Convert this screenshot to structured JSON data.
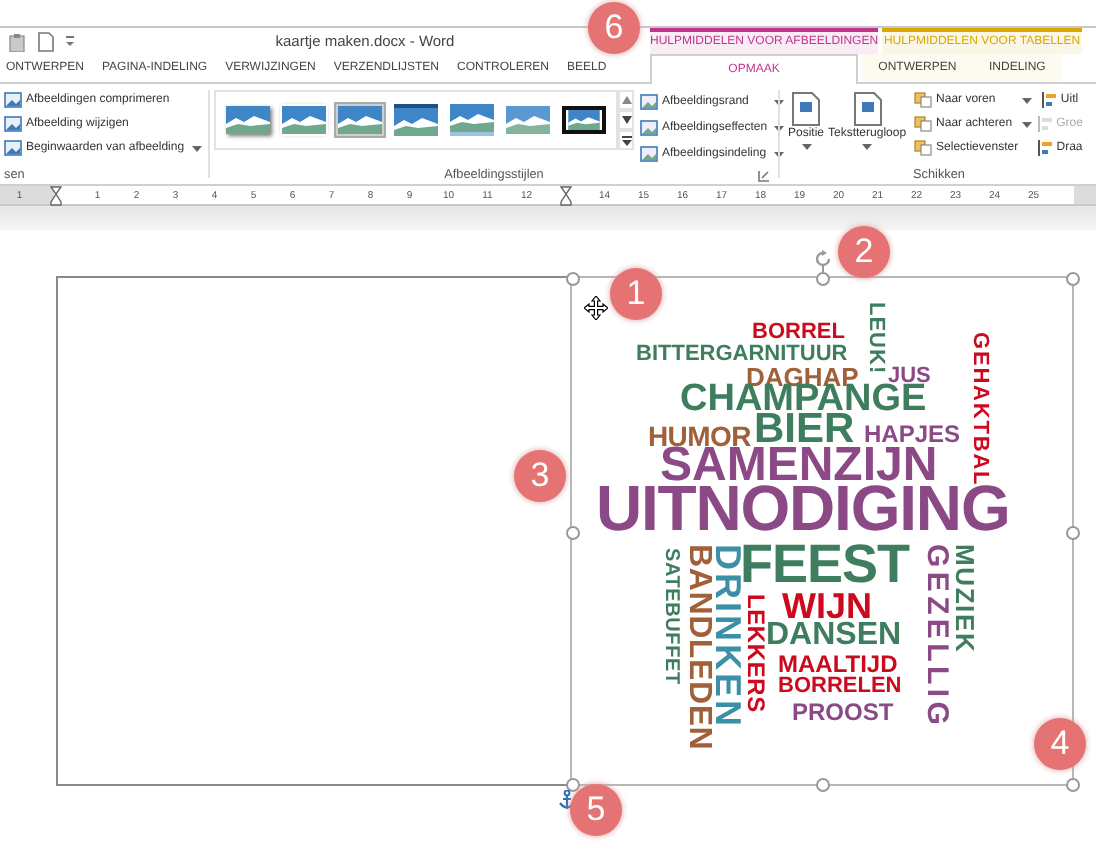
{
  "window": {
    "title": "kaartje maken.docx - Word"
  },
  "tabs": [
    {
      "label": "ONTWERPEN",
      "selected": false
    },
    {
      "label": "PAGINA-INDELING",
      "selected": false
    },
    {
      "label": "VERWIJZINGEN",
      "selected": false
    },
    {
      "label": "VERZENDLIJSTEN",
      "selected": false
    },
    {
      "label": "CONTROLEREN",
      "selected": false
    },
    {
      "label": "BEELD",
      "selected": false
    }
  ],
  "contextual_tabs": [
    {
      "label": "HULPMIDDELEN VOOR AFBEELDINGEN",
      "color": "#c2358c",
      "tabs": [
        {
          "label": "OPMAAK",
          "selected": true
        }
      ]
    },
    {
      "label": "HULPMIDDELEN VOOR TABELLEN",
      "color": "#d9a800",
      "tabs": [
        {
          "label": "ONTWERPEN",
          "selected": false
        },
        {
          "label": "INDELING",
          "selected": false
        }
      ]
    }
  ],
  "ribbon": {
    "adjust": {
      "label": "sen",
      "commands": [
        {
          "label": "Afbeeldingen comprimeren",
          "dropdown": false
        },
        {
          "label": "Afbeelding wijzigen",
          "dropdown": false
        },
        {
          "label": "Beginwaarden van afbeelding",
          "dropdown": true
        }
      ]
    },
    "styles": {
      "label": "Afbeeldingsstijlen",
      "gallery": [
        {
          "kind": "shadow",
          "selected": false
        },
        {
          "kind": "border",
          "selected": false
        },
        {
          "kind": "plain",
          "selected": true
        },
        {
          "kind": "thick",
          "selected": false
        },
        {
          "kind": "reflection",
          "selected": false
        },
        {
          "kind": "soft",
          "selected": false
        },
        {
          "kind": "black",
          "selected": false
        }
      ],
      "commands": [
        {
          "label": "Afbeeldingsrand",
          "dropdown": true
        },
        {
          "label": "Afbeeldingseffecten",
          "dropdown": true
        },
        {
          "label": "Afbeeldingsindeling",
          "dropdown": true
        }
      ]
    },
    "arrange": {
      "label": "Schikken",
      "large": [
        {
          "label": "Positie",
          "dropdown": true
        },
        {
          "label": "Tekstterugloop",
          "dropdown": true
        }
      ],
      "commands": [
        {
          "label": "Naar voren",
          "dropdown": true
        },
        {
          "label": "Naar achteren",
          "dropdown": true
        },
        {
          "label": "Selectievenster",
          "dropdown": false
        }
      ],
      "more": [
        {
          "label": "Uitl",
          "disabled": false
        },
        {
          "label": "Groe",
          "disabled": true
        },
        {
          "label": "Draa",
          "disabled": false
        }
      ]
    }
  },
  "ruler": {
    "labels": [
      "1",
      "1",
      "2",
      "3",
      "4",
      "5",
      "6",
      "7",
      "8",
      "9",
      "10",
      "11",
      "12",
      "14",
      "15",
      "16",
      "17",
      "18",
      "19",
      "20",
      "21",
      "22",
      "23",
      "24",
      "25"
    ]
  },
  "word_cloud": {
    "words": [
      {
        "text": "BORREL",
        "kind": "horizontal",
        "color": "#cc0a1e"
      },
      {
        "text": "LEUK!",
        "kind": "vertical",
        "color": "#3e7d5e"
      },
      {
        "text": "BITTERGARNITUUR",
        "kind": "horizontal",
        "color": "#3e7d5e"
      },
      {
        "text": "GEHAKTBAL",
        "kind": "vertical",
        "color": "#cc0a1e"
      },
      {
        "text": "DAGHAP",
        "kind": "horizontal",
        "color": "#a0603a"
      },
      {
        "text": "JUS",
        "kind": "horizontal",
        "color": "#8b4a85"
      },
      {
        "text": "CHAMPANGE",
        "kind": "horizontal",
        "color": "#3e7d5e"
      },
      {
        "text": "HUMOR",
        "kind": "horizontal",
        "color": "#a0603a"
      },
      {
        "text": "BIER",
        "kind": "horizontal",
        "color": "#3e7d5e"
      },
      {
        "text": "HAPJES",
        "kind": "horizontal",
        "color": "#8b4a85"
      },
      {
        "text": "SAMENZIJN",
        "kind": "horizontal",
        "color": "#8b4a85"
      },
      {
        "text": "UITNODIGING",
        "kind": "horizontal",
        "color": "#8b4a85"
      },
      {
        "text": "SATEBUFFET",
        "kind": "vertical",
        "color": "#3e7d5e"
      },
      {
        "text": "BANDLEDEN",
        "kind": "vertical",
        "color": "#a0603a"
      },
      {
        "text": "DRINKEN",
        "kind": "vertical",
        "color": "#3b8fa6"
      },
      {
        "text": "FEEST",
        "kind": "horizontal",
        "color": "#3e7d5e"
      },
      {
        "text": "LEKKERS",
        "kind": "vertical",
        "color": "#cc0a1e"
      },
      {
        "text": "WIJN",
        "kind": "horizontal",
        "color": "#cc0a1e"
      },
      {
        "text": "DANSEN",
        "kind": "horizontal",
        "color": "#3e7d5e"
      },
      {
        "text": "MAALTIJD",
        "kind": "horizontal",
        "color": "#cc0a1e"
      },
      {
        "text": "BORRELEN",
        "kind": "horizontal",
        "color": "#cc0a1e"
      },
      {
        "text": "PROOST",
        "kind": "horizontal",
        "color": "#8b4a85"
      },
      {
        "text": "GEZELLIG",
        "kind": "vertical",
        "color": "#8b4a85"
      },
      {
        "text": "MUZIEK",
        "kind": "vertical",
        "color": "#3e7d5e"
      }
    ]
  },
  "callouts": [
    "1",
    "2",
    "3",
    "4",
    "5",
    "6"
  ]
}
